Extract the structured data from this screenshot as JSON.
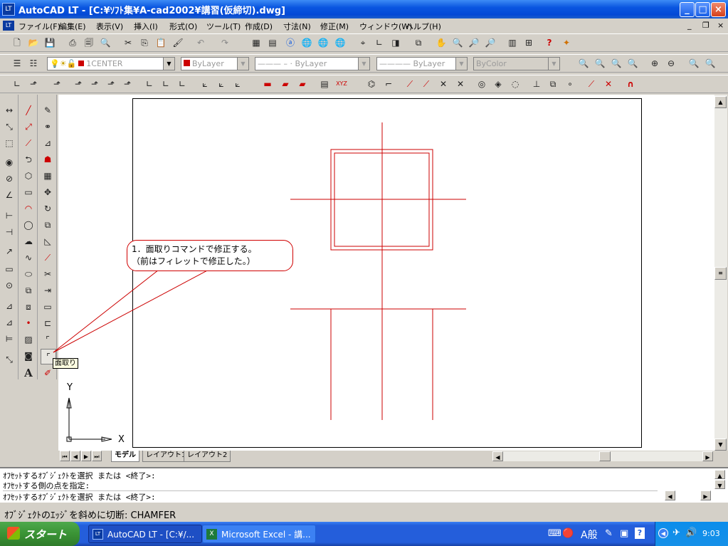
{
  "window": {
    "title": "AutoCAD LT - [C:¥ｿﾌﾄ集¥A-cad2002¥講習(仮締切).dwg]",
    "app_icon": "LT",
    "min": "_",
    "max": "□",
    "close": "×"
  },
  "menu": [
    "ファイル(F)",
    "編集(E)",
    "表示(V)",
    "挿入(I)",
    "形式(O)",
    "ツール(T)",
    "作成(D)",
    "寸法(N)",
    "修正(M)",
    "ウィンドウ(W)",
    "ヘルプ(H)"
  ],
  "properties": {
    "layer": "1CENTER",
    "color": "ByLayer",
    "linetype": "ByLayer",
    "lineweight": "ByLayer",
    "plotstyle": "ByColor"
  },
  "tabs": [
    "モデル",
    "レイアウト1",
    "レイアウト2"
  ],
  "callout": {
    "line1": "1．面取りコマンドで修正する。",
    "line2": "（前はフィレットで修正した。）"
  },
  "tooltip": "面取り",
  "ucs": {
    "x": "X",
    "y": "Y"
  },
  "command_lines": [
    "ｵﾌｾｯﾄするｵﾌﾞｼﾞｪｸﾄを選択 または <終了>:",
    "ｵﾌｾｯﾄする側の点を指定:",
    "ｵﾌｾｯﾄするｵﾌﾞｼﾞｪｸﾄを選択 または <終了>:"
  ],
  "status_text": "ｵﾌﾞｼﾞｪｸﾄのｴｯｼﾞを斜めに切断:  CHAMFER",
  "taskbar": {
    "start": "スタート",
    "tasks": [
      "AutoCAD LT - [C:¥/...",
      "Microsoft Excel - 講..."
    ],
    "ime": "A般",
    "clock": "9:03"
  },
  "colors": {
    "drawing": "#cc0000",
    "titlebar": "#0a56e0",
    "taskbar": "#245edb"
  }
}
